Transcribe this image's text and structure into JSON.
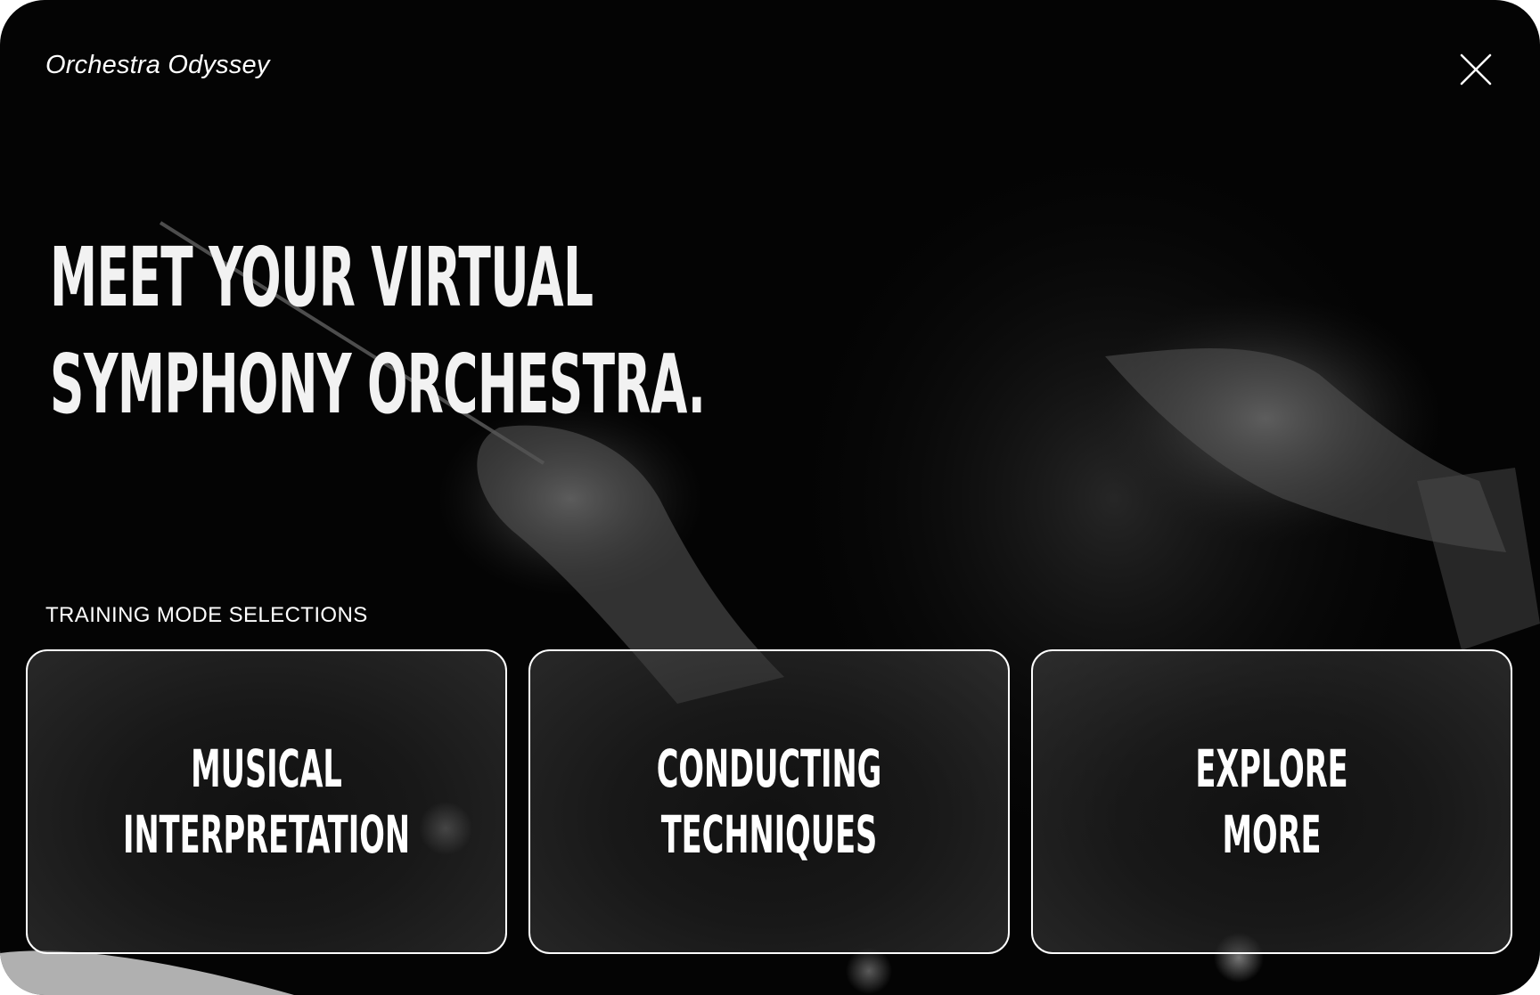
{
  "app": {
    "brand": "Orchestra Odyssey"
  },
  "header": {
    "close_icon": "close-x-icon"
  },
  "hero": {
    "line1": "MEET YOUR VIRTUAL",
    "line2": "SYMPHONY ORCHESTRA."
  },
  "training": {
    "label": "TRAINING MODE SELECTIONS",
    "cards": [
      {
        "line1": "MUSICAL",
        "line2": "INTERPRETATION"
      },
      {
        "line1": "CONDUCTING",
        "line2": "TECHNIQUES"
      },
      {
        "line1": "EXPLORE",
        "line2": "MORE"
      }
    ]
  },
  "colors": {
    "background": "#040404",
    "text": "#ffffff",
    "card_border": "#ffffff"
  }
}
